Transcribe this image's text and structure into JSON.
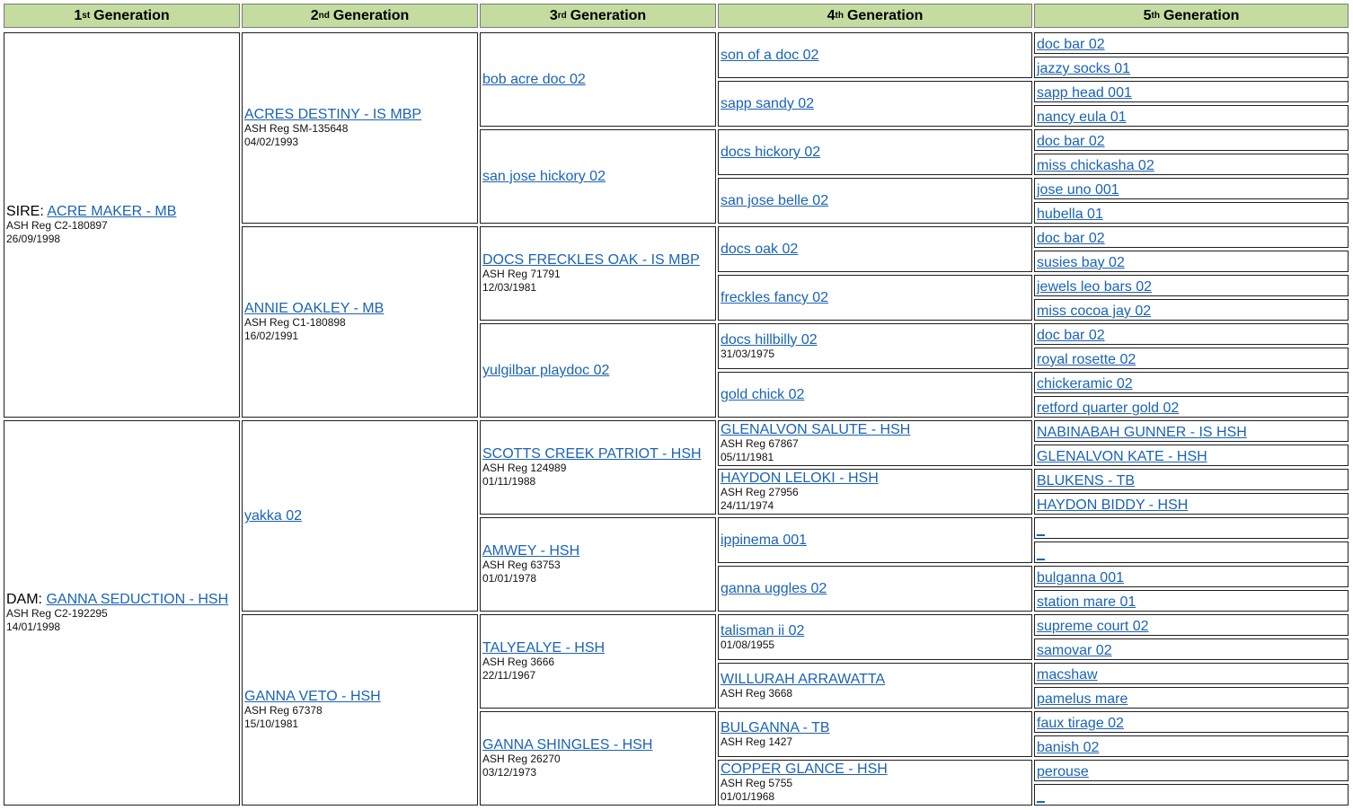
{
  "headers": [
    {
      "label": "Generation",
      "sup": "st",
      "num": "1"
    },
    {
      "label": "Generation",
      "sup": "nd",
      "num": "2"
    },
    {
      "label": "Generation",
      "sup": "rd",
      "num": "3"
    },
    {
      "label": "Generation",
      "sup": "th",
      "num": "4"
    },
    {
      "label": "Generation",
      "sup": "th",
      "num": "5"
    }
  ],
  "g1": [
    {
      "prefix": "SIRE: ",
      "name": "ACRE MAKER - MB",
      "reg": "ASH Reg C2-180897",
      "dob": "26/09/1998"
    },
    {
      "prefix": "DAM: ",
      "name": "GANNA SEDUCTION - HSH",
      "reg": "ASH Reg C2-192295",
      "dob": "14/01/1998"
    }
  ],
  "g2": [
    {
      "name": "ACRES DESTINY - IS MBP",
      "reg": "ASH Reg SM-135648",
      "dob": "04/02/1993"
    },
    {
      "name": "ANNIE OAKLEY - MB",
      "reg": "ASH Reg C1-180898",
      "dob": "16/02/1991"
    },
    {
      "name": "yakka 02",
      "reg": "",
      "dob": ""
    },
    {
      "name": "GANNA VETO - HSH",
      "reg": "ASH Reg 67378",
      "dob": "15/10/1981"
    }
  ],
  "g3": [
    {
      "name": "bob acre doc 02",
      "reg": "",
      "dob": ""
    },
    {
      "name": "san jose hickory 02",
      "reg": "",
      "dob": ""
    },
    {
      "name": "DOCS FRECKLES OAK - IS MBP",
      "reg": "ASH Reg 71791",
      "dob": "12/03/1981"
    },
    {
      "name": "yulgilbar playdoc 02",
      "reg": "",
      "dob": ""
    },
    {
      "name": "SCOTTS CREEK PATRIOT - HSH",
      "reg": "ASH Reg 124989",
      "dob": "01/11/1988"
    },
    {
      "name": "AMWEY - HSH",
      "reg": "ASH Reg 63753",
      "dob": "01/01/1978"
    },
    {
      "name": "TALYEALYE - HSH",
      "reg": "ASH Reg 3666",
      "dob": "22/11/1967"
    },
    {
      "name": "GANNA SHINGLES - HSH",
      "reg": "ASH Reg 26270",
      "dob": "03/12/1973"
    }
  ],
  "g4": [
    {
      "name": "son of a doc 02",
      "reg": "",
      "dob": ""
    },
    {
      "name": "sapp sandy 02",
      "reg": "",
      "dob": ""
    },
    {
      "name": "docs hickory 02",
      "reg": "",
      "dob": ""
    },
    {
      "name": "san jose belle 02",
      "reg": "",
      "dob": ""
    },
    {
      "name": "docs oak 02",
      "reg": "",
      "dob": ""
    },
    {
      "name": "freckles fancy 02",
      "reg": "",
      "dob": ""
    },
    {
      "name": "docs hillbilly 02",
      "reg": "",
      "dob": "31/03/1975"
    },
    {
      "name": "gold chick 02",
      "reg": "",
      "dob": ""
    },
    {
      "name": "GLENALVON SALUTE - HSH",
      "reg": "ASH Reg 67867",
      "dob": "05/11/1981"
    },
    {
      "name": "HAYDON LELOKI - HSH",
      "reg": "ASH Reg 27956",
      "dob": "24/11/1974"
    },
    {
      "name": "ippinema 001",
      "reg": "",
      "dob": ""
    },
    {
      "name": "ganna uggles 02",
      "reg": "",
      "dob": ""
    },
    {
      "name": "talisman ii 02",
      "reg": "",
      "dob": "01/08/1955"
    },
    {
      "name": "WILLURAH ARRAWATTA",
      "reg": "ASH Reg 3668",
      "dob": ""
    },
    {
      "name": "BULGANNA - TB",
      "reg": "ASH Reg 1427",
      "dob": ""
    },
    {
      "name": "COPPER GLANCE - HSH",
      "reg": "ASH Reg 5755",
      "dob": "01/01/1968"
    }
  ],
  "g5": [
    "doc bar 02",
    "jazzy socks 01",
    "sapp head 001",
    "nancy eula 01",
    "doc bar 02",
    "miss chickasha 02",
    "jose uno 001",
    "hubella 01",
    "doc bar 02",
    "susies bay 02",
    "jewels leo bars 02",
    "miss cocoa jay 02",
    "doc bar 02",
    "royal rosette 02",
    "chickeramic 02",
    "retford quarter gold 02",
    "NABINABAH GUNNER - IS HSH",
    "GLENALVON KATE - HSH",
    "BLUKENS - TB",
    "HAYDON BIDDY - HSH",
    "_",
    "_",
    "bulganna 001",
    "station mare 01",
    "supreme court 02",
    "samovar 02",
    "macshaw",
    "pamelus mare",
    "faux tirage 02",
    "banish 02",
    "perouse",
    "_"
  ]
}
